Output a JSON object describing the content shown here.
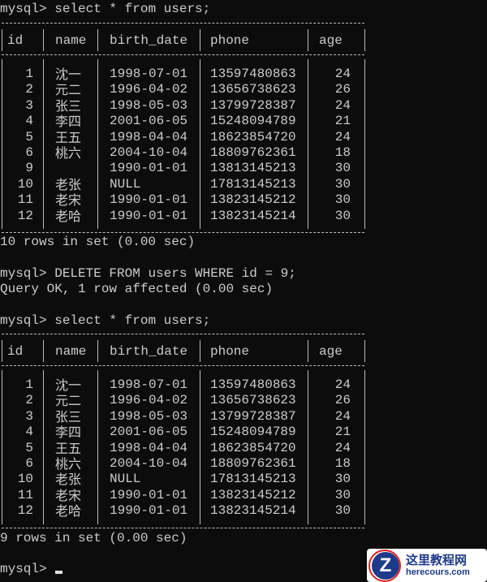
{
  "prompt": "mysql>",
  "commands": {
    "select1": "select * from users;",
    "delete": "DELETE FROM users WHERE id = 9;",
    "select2": "select * from users;"
  },
  "messages": {
    "rows_before": "10 rows in set (0.00 sec)",
    "query_ok": "Query OK, 1 row affected (0.00 sec)",
    "rows_after": "9 rows in set (0.00 sec)"
  },
  "columns": [
    "id",
    "name",
    "birth_date",
    "phone",
    "age"
  ],
  "table_before": [
    [
      "1",
      "沈一",
      "1998-07-01",
      "13597480863",
      "24"
    ],
    [
      "2",
      "元二",
      "1996-04-02",
      "13656738623",
      "26"
    ],
    [
      "3",
      "张三",
      "1998-05-03",
      "13799728387",
      "24"
    ],
    [
      "4",
      "李四",
      "2001-06-05",
      "15248094789",
      "21"
    ],
    [
      "5",
      "王五",
      "1998-04-04",
      "18623854720",
      "24"
    ],
    [
      "6",
      "桃六",
      "2004-10-04",
      "18809762361",
      "18"
    ],
    [
      "9",
      "",
      "1990-01-01",
      "13813145213",
      "30"
    ],
    [
      "10",
      "老张",
      "NULL",
      "17813145213",
      "30"
    ],
    [
      "11",
      "老宋",
      "1990-01-01",
      "13823145212",
      "30"
    ],
    [
      "12",
      "老哈",
      "1990-01-01",
      "13823145214",
      "30"
    ]
  ],
  "table_after": [
    [
      "1",
      "沈一",
      "1998-07-01",
      "13597480863",
      "24"
    ],
    [
      "2",
      "元二",
      "1996-04-02",
      "13656738623",
      "26"
    ],
    [
      "3",
      "张三",
      "1998-05-03",
      "13799728387",
      "24"
    ],
    [
      "4",
      "李四",
      "2001-06-05",
      "15248094789",
      "21"
    ],
    [
      "5",
      "王五",
      "1998-04-04",
      "18623854720",
      "24"
    ],
    [
      "6",
      "桃六",
      "2004-10-04",
      "18809762361",
      "18"
    ],
    [
      "10",
      "老张",
      "NULL",
      "17813145213",
      "30"
    ],
    [
      "11",
      "老宋",
      "1990-01-01",
      "13823145212",
      "30"
    ],
    [
      "12",
      "老哈",
      "1990-01-01",
      "13823145214",
      "30"
    ]
  ],
  "watermark": {
    "logo_letter": "Z",
    "title": "这里教程网",
    "url": "herecours.com"
  },
  "colors": {
    "background": "#0c0c0c",
    "text": "#cccccc",
    "border": "#bdbdbd"
  }
}
